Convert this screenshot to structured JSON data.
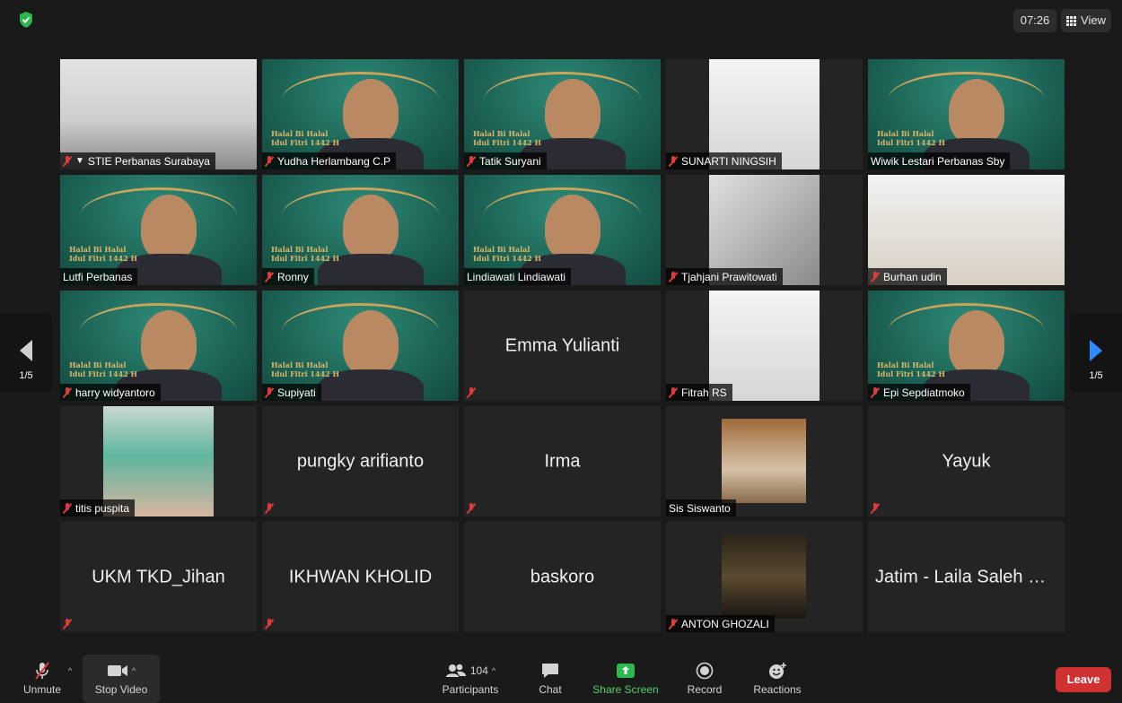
{
  "window": {
    "time": "07:26",
    "view_label": "View"
  },
  "pagination": {
    "left": "1/5",
    "right": "1/5"
  },
  "participants_tiles": [
    {
      "name": "STIE Perbanas Surabaya",
      "muted": true,
      "pinned": true,
      "video": "room",
      "active": true
    },
    {
      "name": "Yudha Herlambang C.P",
      "muted": true,
      "video": "eid"
    },
    {
      "name": "Tatik Suryani",
      "muted": true,
      "video": "eid"
    },
    {
      "name": "SUNARTI NINGSIH",
      "muted": true,
      "video": "white"
    },
    {
      "name": "Wiwik Lestari Perbanas Sby",
      "muted": false,
      "video": "eid"
    },
    {
      "name": "Lutfi Perbanas",
      "muted": false,
      "video": "eid"
    },
    {
      "name": "Ronny",
      "muted": true,
      "video": "eid"
    },
    {
      "name": "Lindiawati Lindiawati",
      "muted": false,
      "video": "eid"
    },
    {
      "name": "Tjahjani Prawitowati",
      "muted": true,
      "video": "gray"
    },
    {
      "name": "Burhan udin",
      "muted": true,
      "video": "office"
    },
    {
      "name": "harry widyantoro",
      "muted": true,
      "video": "eid"
    },
    {
      "name": "Supiyati",
      "muted": true,
      "video": "eid"
    },
    {
      "name": "Emma Yulianti",
      "muted": true,
      "video": "none"
    },
    {
      "name": "Fitrah RS",
      "muted": true,
      "video": "white"
    },
    {
      "name": "Epi Sepdiatmoko",
      "muted": true,
      "video": "eid"
    },
    {
      "name": "titis puspita",
      "muted": true,
      "video": "selfie"
    },
    {
      "name": "pungky arifianto",
      "muted": true,
      "video": "none"
    },
    {
      "name": "Irma",
      "muted": true,
      "video": "none"
    },
    {
      "name": "Sis Siswanto",
      "muted": false,
      "video": "photo"
    },
    {
      "name": "Yayuk",
      "muted": true,
      "video": "none"
    },
    {
      "name": "UKM TKD_Jihan",
      "muted": true,
      "video": "none"
    },
    {
      "name": "IKHWAN KHOLID",
      "muted": true,
      "video": "none"
    },
    {
      "name": "baskoro",
      "muted": false,
      "video": "none"
    },
    {
      "name": "ANTON GHOZALI",
      "muted": true,
      "video": "dark"
    },
    {
      "name": "Jatim - Laila Saleh M...",
      "muted": false,
      "video": "none"
    }
  ],
  "toolbar": {
    "unmute": "Unmute",
    "stop_video": "Stop Video",
    "participants": "Participants",
    "participants_count": "104",
    "chat": "Chat",
    "share_screen": "Share Screen",
    "record": "Record",
    "reactions": "Reactions",
    "leave": "Leave"
  },
  "colors": {
    "active_speaker": "#d4e157",
    "leave": "#d03131",
    "share_green": "#4bd16b",
    "mute_red": "#e03a3a",
    "nav_blue": "#2f8cff"
  }
}
